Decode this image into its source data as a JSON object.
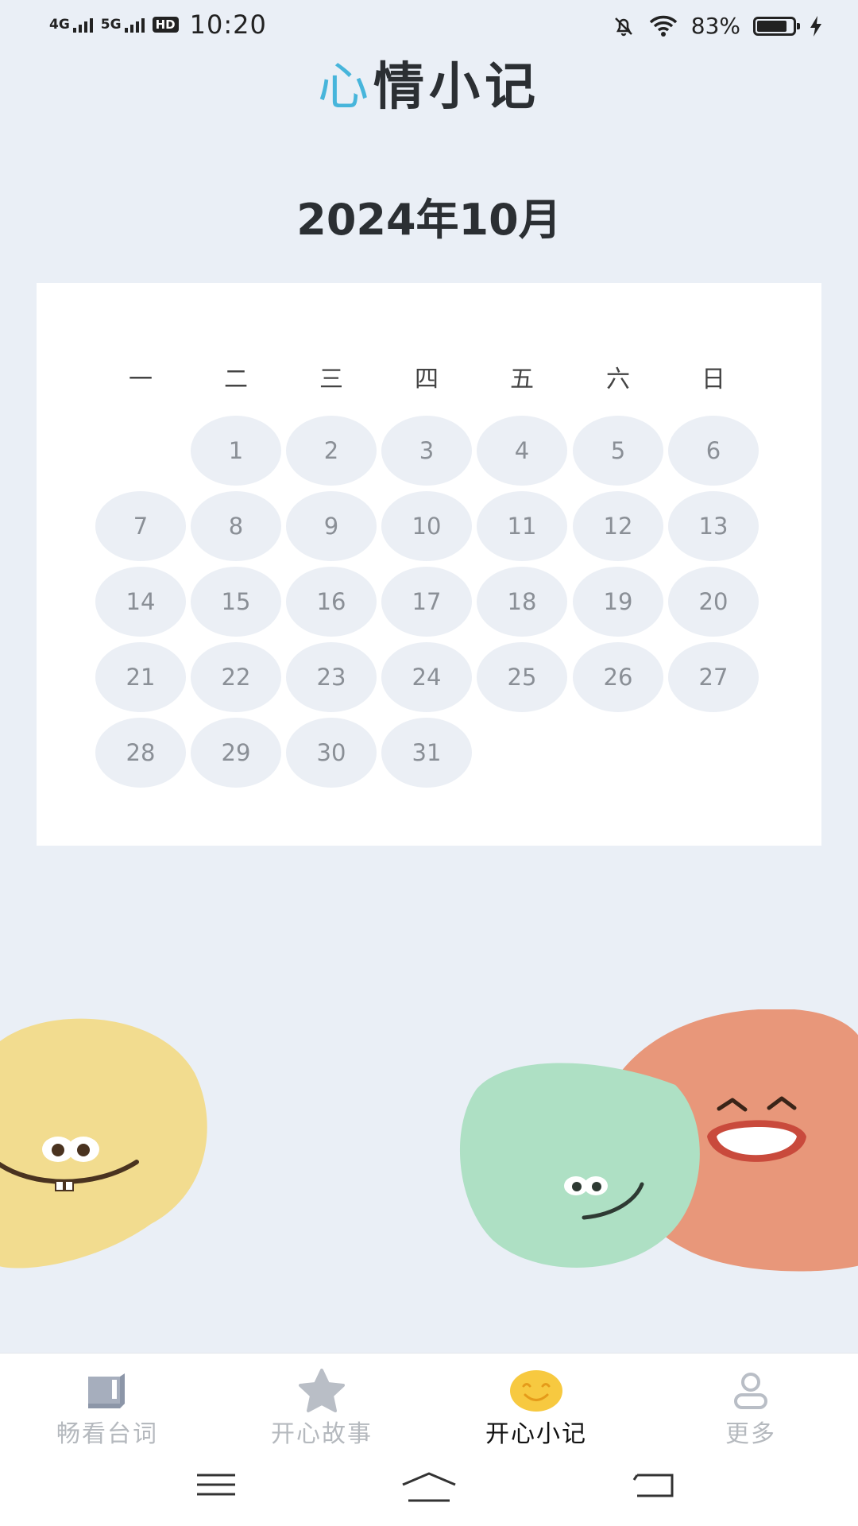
{
  "status_bar": {
    "network1": "4G",
    "network2": "5G",
    "hd": "HD",
    "time": "10:20",
    "battery_text": "83%",
    "battery_level": 0.83
  },
  "header": {
    "title_accent": "心",
    "title_rest": "情小记"
  },
  "calendar": {
    "month_title": "2024年10月",
    "weekdays": [
      "一",
      "二",
      "三",
      "四",
      "五",
      "六",
      "日"
    ],
    "first_weekday_index": 1,
    "days": [
      "1",
      "2",
      "3",
      "4",
      "5",
      "6",
      "7",
      "8",
      "9",
      "10",
      "11",
      "12",
      "13",
      "14",
      "15",
      "16",
      "17",
      "18",
      "19",
      "20",
      "21",
      "22",
      "23",
      "24",
      "25",
      "26",
      "27",
      "28",
      "29",
      "30",
      "31"
    ]
  },
  "bottom_nav": {
    "items": [
      {
        "label": "畅看台词",
        "icon": "book-icon"
      },
      {
        "label": "开心故事",
        "icon": "star-icon"
      },
      {
        "label": "开心小记",
        "icon": "smiley-icon",
        "active": true
      },
      {
        "label": "更多",
        "icon": "person-icon"
      }
    ]
  },
  "colors": {
    "accent": "#47B5DB",
    "background": "#EAEFF6",
    "day_cell": "#EBEFF5",
    "blob_yellow": "#F2DC8F",
    "blob_green": "#AEE0C4",
    "blob_orange": "#E8977A",
    "smiley": "#F7C940"
  }
}
